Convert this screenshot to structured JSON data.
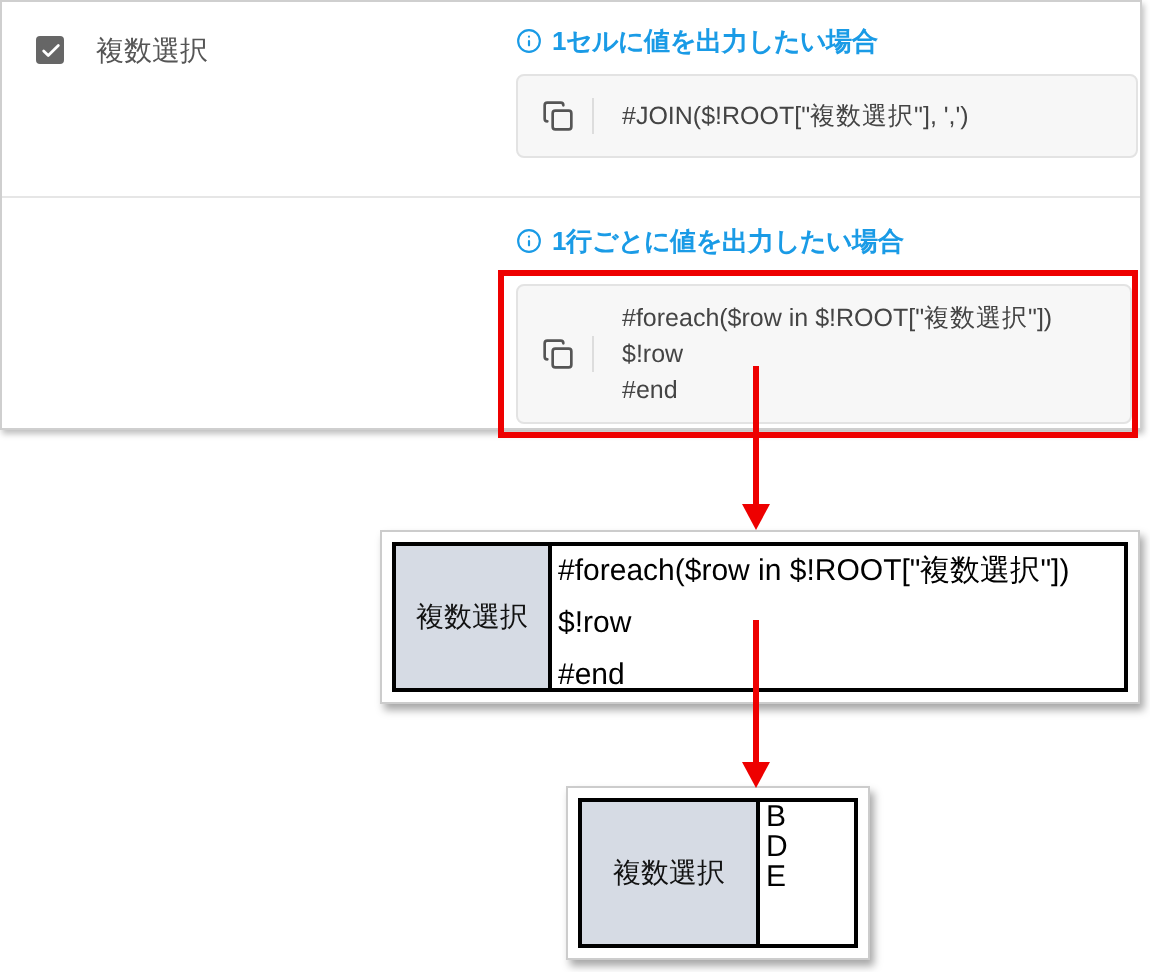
{
  "field": {
    "label": "複数選択",
    "checked": true
  },
  "examples": [
    {
      "heading": "1セルに値を出力したい場合",
      "code": [
        "#JOIN($!ROOT[\"複数選択\"], ',')"
      ],
      "highlighted": false
    },
    {
      "heading": "1行ごとに値を出力したい場合",
      "code": [
        "#foreach($row in $!ROOT[\"複数選択\"])",
        "$!row",
        "#end"
      ],
      "highlighted": true
    }
  ],
  "sheets": [
    {
      "header": "複数選択",
      "lines": [
        "#foreach($row in $!ROOT[\"複数選択\"])",
        "$!row",
        "#end"
      ]
    },
    {
      "header": "複数選択",
      "lines": [
        "B",
        "D",
        "E"
      ]
    }
  ]
}
